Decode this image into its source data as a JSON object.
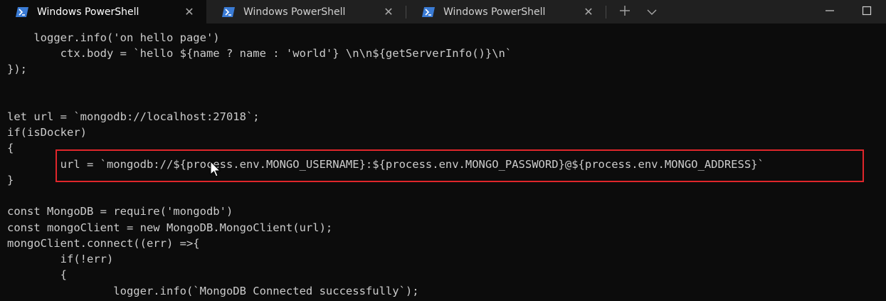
{
  "tabs": [
    {
      "title": "Windows PowerShell",
      "active": true
    },
    {
      "title": "Windows PowerShell",
      "active": false
    },
    {
      "title": "Windows PowerShell",
      "active": false
    }
  ],
  "tab_actions": {
    "new_tab_icon": "plus-icon",
    "dropdown_icon": "chevron-down-icon"
  },
  "window_controls": {
    "minimize_icon": "minimize-icon",
    "maximize_icon": "maximize-icon"
  },
  "terminal": {
    "lines": [
      "    logger.info('on hello page')",
      "        ctx.body = `hello ${name ? name : 'world'} \\n\\n${getServerInfo()}\\n`",
      "});",
      "",
      "",
      "let url = `mongodb://localhost:27018`;",
      "if(isDocker)",
      "{",
      "        url = `mongodb://${process.env.MONGO_USERNAME}:${process.env.MONGO_PASSWORD}@${process.env.MONGO_ADDRESS}`",
      "}",
      "",
      "const MongoDB = require('mongodb')",
      "const mongoClient = new MongoDB.MongoClient(url);",
      "mongoClient.connect((err) =>{",
      "        if(!err)",
      "        {",
      "                logger.info(`MongoDB Connected successfully`);"
    ],
    "highlighted_line_index": 8
  },
  "colors": {
    "terminal_bg": "#0c0c0c",
    "titlebar_bg": "#202020",
    "text": "#cccccc",
    "highlight_border": "#e0262b",
    "powershell_icon": "#3a7bd5"
  }
}
